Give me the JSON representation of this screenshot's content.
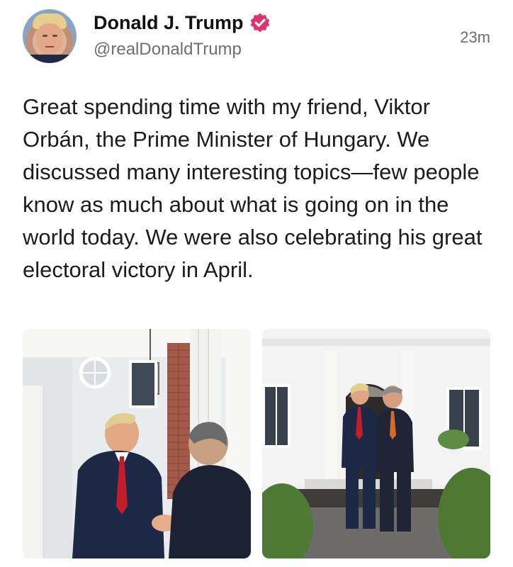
{
  "post": {
    "author": {
      "display_name": "Donald J. Trump",
      "handle": "@realDonaldTrump",
      "verified": true,
      "verified_color": "#d9376e"
    },
    "timestamp": "23m",
    "text": "Great spending time with my friend, Viktor Orbán, the Prime Minister of Hungary. We discussed many interesting topics—few people know as much about what is going on in the world today. We were also celebrating his great electoral victory in April.",
    "media": [
      {
        "kind": "photo"
      },
      {
        "kind": "photo"
      }
    ]
  }
}
